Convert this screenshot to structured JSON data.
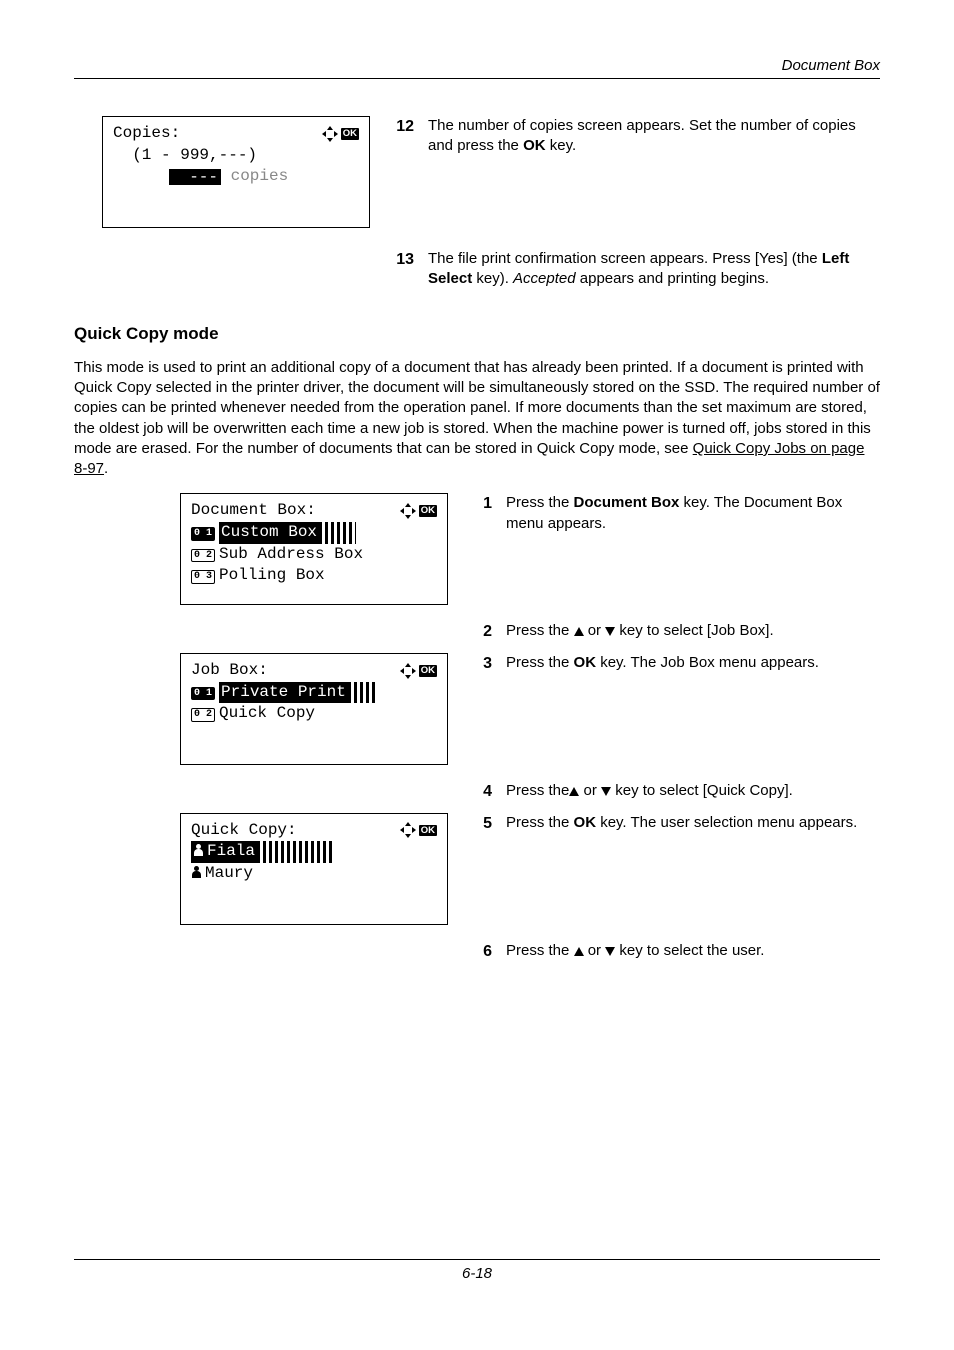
{
  "header": {
    "section": "Document Box"
  },
  "lcd_copies": {
    "title": "Copies:",
    "range": "  (1 - 999,---)",
    "dashes": "---",
    "unit": " copies"
  },
  "steps_top": {
    "n12": "12",
    "t12_a": "The number of copies screen appears. Set the number of copies and press the ",
    "t12_b": "OK",
    "t12_c": " key.",
    "n13": "13",
    "t13_a": "The file print confirmation screen appears. Press [Yes] (the ",
    "t13_b": "Left Select",
    "t13_c": " key). ",
    "t13_d": "Accepted",
    "t13_e": " appears and printing begins."
  },
  "qc": {
    "heading": "Quick Copy mode",
    "para_a": "This mode is used to print an additional copy of a document that has already been printed. If a document is printed with Quick Copy selected in the printer driver, the document will be simultaneously stored on the SSD. The required number of copies can be printed whenever needed from the operation panel. If more documents than the set maximum are stored, the oldest job will be overwritten each time a new job is stored. When the machine power is turned off, jobs stored in this mode are erased. For the number of documents that can be stored in Quick Copy mode, see ",
    "para_link": "Quick Copy Jobs on page 8-97",
    "para_b": "."
  },
  "lcd_docbox": {
    "title": "Document Box:",
    "n1": "0 1",
    "i1": "Custom Box",
    "n2": "0 2",
    "i2": "Sub Address Box",
    "n3": "0 3",
    "i3": "Polling Box"
  },
  "lcd_jobbox": {
    "title": "Job Box:",
    "n1": "0 1",
    "i1": "Private Print",
    "n2": "0 2",
    "i2": "Quick Copy"
  },
  "lcd_quick": {
    "title": "Quick Copy:",
    "u1": "Fiala",
    "u2": "Maury"
  },
  "steps_bottom": {
    "n1": "1",
    "t1_a": "Press the ",
    "t1_b": "Document Box",
    "t1_c": " key. The Document Box menu appears.",
    "n2": "2",
    "t2_a": "Press the ",
    "t2_b": " or ",
    "t2_c": " key to select [Job Box].",
    "n3": "3",
    "t3_a": "Press the ",
    "t3_b": "OK",
    "t3_c": " key. The Job Box menu appears.",
    "n4": "4",
    "t4_a": "Press the",
    "t4_b": " or ",
    "t4_c": " key to select [Quick Copy].",
    "n5": "5",
    "t5_a": "Press the ",
    "t5_b": "OK",
    "t5_c": " key. The user selection menu appears.",
    "n6": "6",
    "t6_a": "Press the ",
    "t6_b": " or ",
    "t6_c": " key to select the user."
  },
  "footer": {
    "page": "6-18"
  }
}
